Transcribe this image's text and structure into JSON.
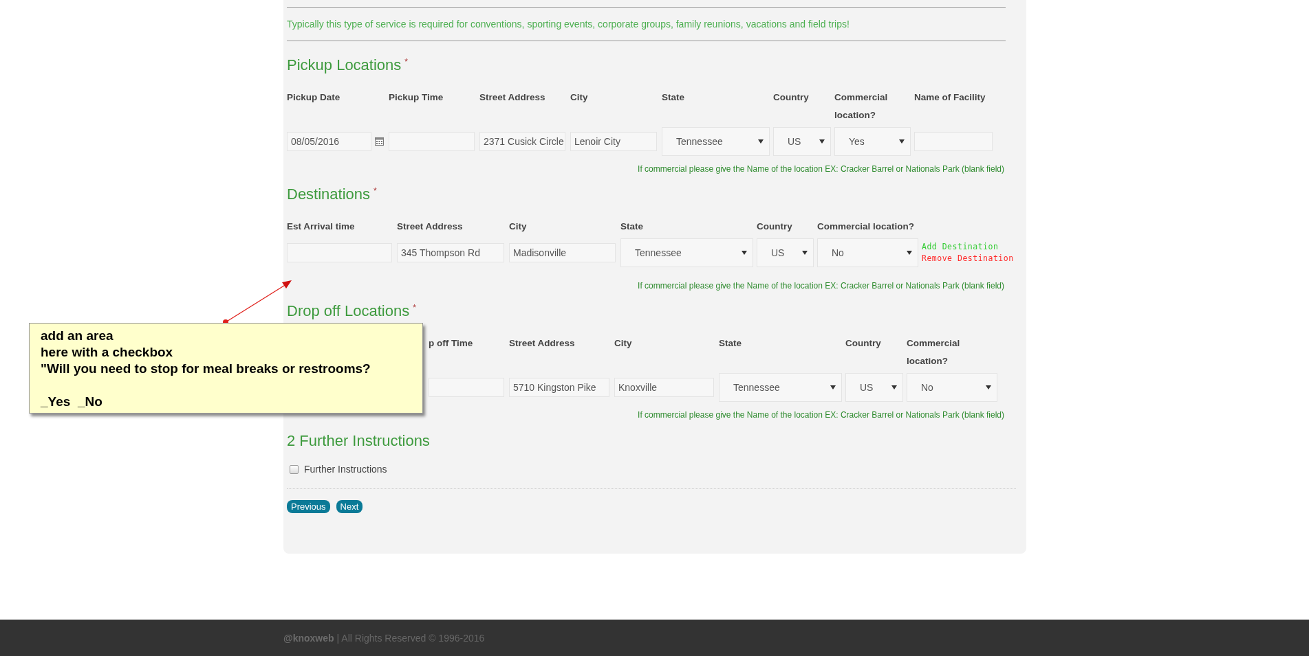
{
  "intro": "Typically this type of service is required for conventions, sporting events, corporate groups, family reunions, vacations and field trips!",
  "sections": [
    {
      "title": "Pickup Locations",
      "required_mark": "*",
      "columns": [
        "Pickup Date",
        "Pickup Time",
        "Street Address",
        "City",
        "State",
        "Country",
        "Commercial location?",
        "Name of Facility"
      ],
      "fields": [
        {
          "kind": "date",
          "value": "08/05/2016"
        },
        {
          "kind": "text"
        },
        {
          "kind": "text",
          "value": "2371 Cusick Circle"
        },
        {
          "kind": "text",
          "value": "Lenoir City"
        },
        {
          "kind": "select",
          "value": "Tennessee"
        },
        {
          "kind": "select",
          "value": "US"
        },
        {
          "kind": "select",
          "value": "Yes"
        },
        {
          "kind": "text"
        }
      ],
      "hint": "If commercial please give the Name of the location EX: Cracker Barrel or Nationals Park (blank field)"
    },
    {
      "title": "Destinations",
      "required_mark": "*",
      "columns": [
        "Est Arrival time",
        "Street Address",
        "City",
        "State",
        "Country",
        "Commercial location?"
      ],
      "fields": [
        {
          "kind": "text"
        },
        {
          "kind": "text",
          "value": "345 Thompson Rd"
        },
        {
          "kind": "text",
          "value": "Madisonville"
        },
        {
          "kind": "select",
          "value": "Tennessee"
        },
        {
          "kind": "select",
          "value": "US"
        },
        {
          "kind": "select",
          "value": "No"
        }
      ],
      "actions": [
        {
          "kind": "add",
          "label": "Add Destination"
        },
        {
          "kind": "remove",
          "label": "Remove Destination"
        }
      ],
      "hint": "If commercial please give the Name of the location EX: Cracker Barrel or Nationals Park (blank field)"
    },
    {
      "title": "Drop off Locations",
      "required_mark": "*",
      "columns": [
        "p off Time",
        "Street Address",
        "City",
        "State",
        "Country",
        "Commercial location?"
      ],
      "fields": [
        {
          "kind": "text"
        },
        {
          "kind": "text",
          "value": "5710 Kingston Pike"
        },
        {
          "kind": "text",
          "value": "Knoxville"
        },
        {
          "kind": "select",
          "value": "Tennessee"
        },
        {
          "kind": "select",
          "value": "US"
        },
        {
          "kind": "select",
          "value": "No"
        }
      ],
      "hint": "If commercial please give the Name of the location EX: Cracker Barrel or Nationals Park (blank field)"
    }
  ],
  "further": {
    "title": "2 Further Instructions",
    "checkbox": {
      "label": "Further Instructions",
      "checked": false
    }
  },
  "buttons": [
    "Previous",
    "Next"
  ],
  "footer": {
    "brand": "@knoxweb",
    "text": "| All Rights Reserved © 1996-2016"
  },
  "annotation": {
    "paragraphs": [
      [
        "add an area",
        "here with a checkbox",
        "\"Will you need to stop for meal breaks or restrooms?"
      ],
      [
        "_Yes  _No"
      ]
    ]
  }
}
